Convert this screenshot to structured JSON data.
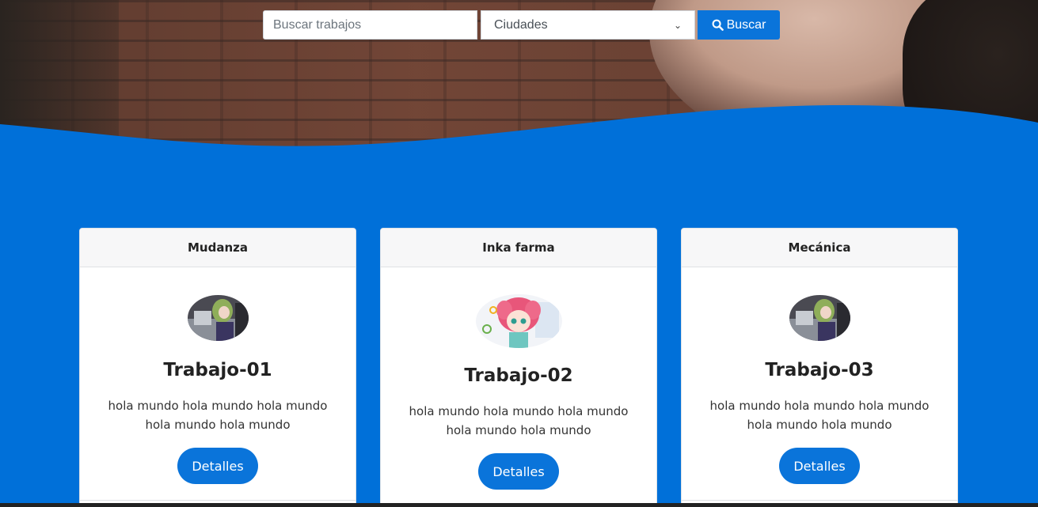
{
  "search": {
    "placeholder": "Buscar trabajos",
    "city_select": "Ciudades",
    "button_label": "Buscar"
  },
  "colors": {
    "accent": "#0070d9",
    "button": "#0a74da"
  },
  "cards": [
    {
      "header": "Mudanza",
      "title": "Trabajo-01",
      "text": "hola mundo hola mundo hola mundo hola mundo hola mundo",
      "button": "Detalles",
      "avatar": "anime-girl-computer"
    },
    {
      "header": "Inka farma",
      "title": "Trabajo-02",
      "text": "hola mundo hola mundo hola mundo hola mundo hola mundo",
      "button": "Detalles",
      "avatar": "anime-girl-pink-hair"
    },
    {
      "header": "Mecánica",
      "title": "Trabajo-03",
      "text": "hola mundo hola mundo hola mundo hola mundo hola mundo",
      "button": "Detalles",
      "avatar": "anime-girl-computer"
    }
  ]
}
